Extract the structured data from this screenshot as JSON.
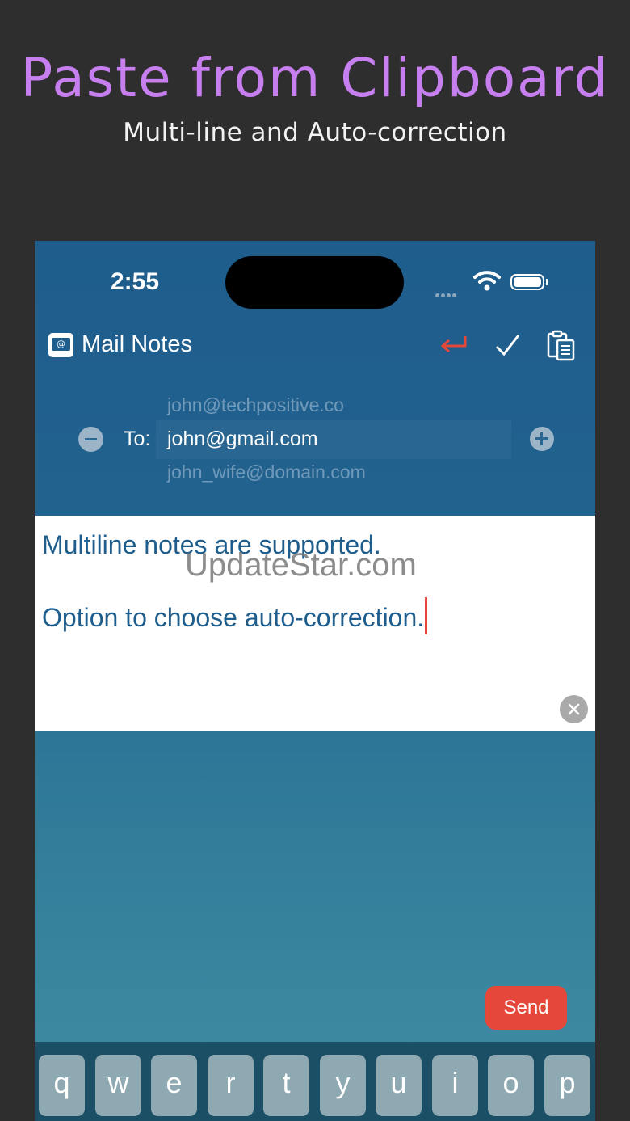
{
  "headline": "Paste from Clipboard",
  "subline": "Multi-line and Auto-correction",
  "status": {
    "time": "2:55"
  },
  "app": {
    "title": "Mail Notes"
  },
  "recipients": {
    "above": "john@techpositive.co",
    "to_label": "To:",
    "current": "john@gmail.com",
    "below": "john_wife@domain.com"
  },
  "note": {
    "line1": "Multiline notes are supported.",
    "line2": "Option to choose auto-correction."
  },
  "watermark": "UpdateStar.com",
  "send_label": "Send",
  "keyboard": {
    "keys": [
      "q",
      "w",
      "e",
      "r",
      "t",
      "y",
      "u",
      "i",
      "o",
      "p"
    ]
  },
  "colors": {
    "headline": "#c77ff0",
    "accent_red": "#e5483a",
    "note_text": "#1e5d8c",
    "background": "#2e2e2e"
  }
}
